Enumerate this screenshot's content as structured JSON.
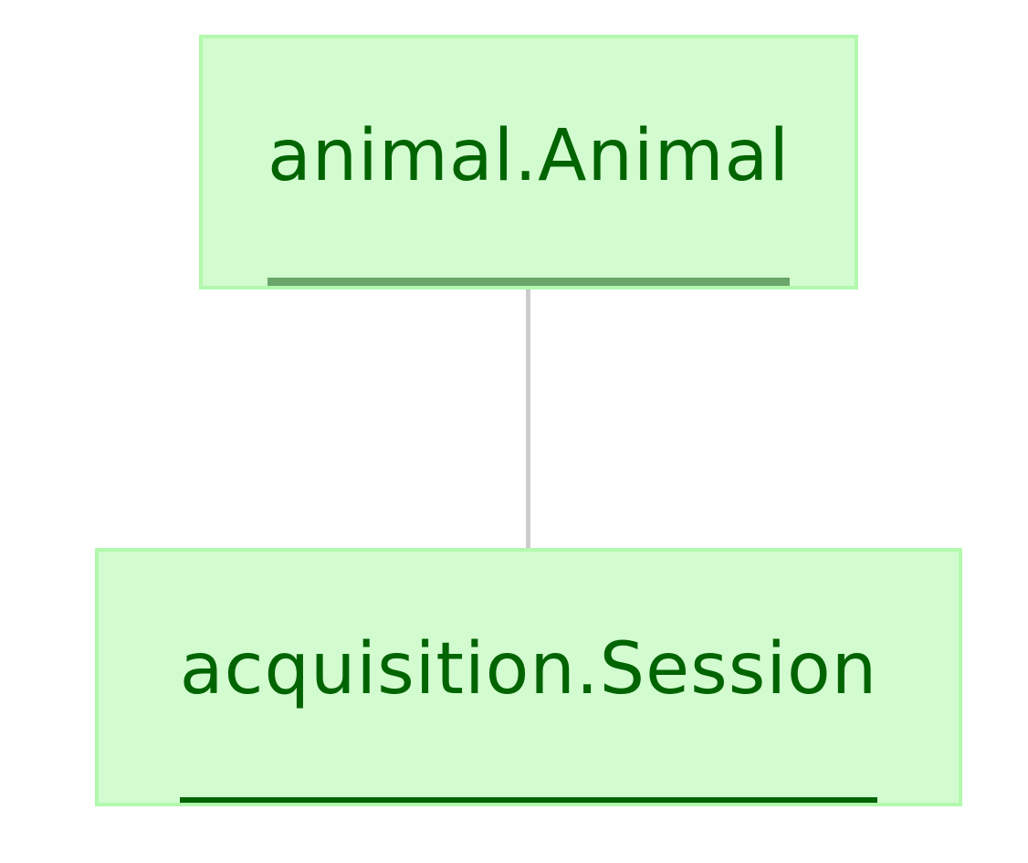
{
  "diagram": {
    "nodes": [
      {
        "label": "animal.Animal"
      },
      {
        "label": "acquisition.Session"
      }
    ],
    "edges": [
      {
        "from": "animal.Animal",
        "to": "acquisition.Session"
      }
    ],
    "colors": {
      "node_fill": "#d2fccf",
      "node_border": "#b2f8ad",
      "label_text": "#006400",
      "edge": "#cccccc"
    }
  }
}
